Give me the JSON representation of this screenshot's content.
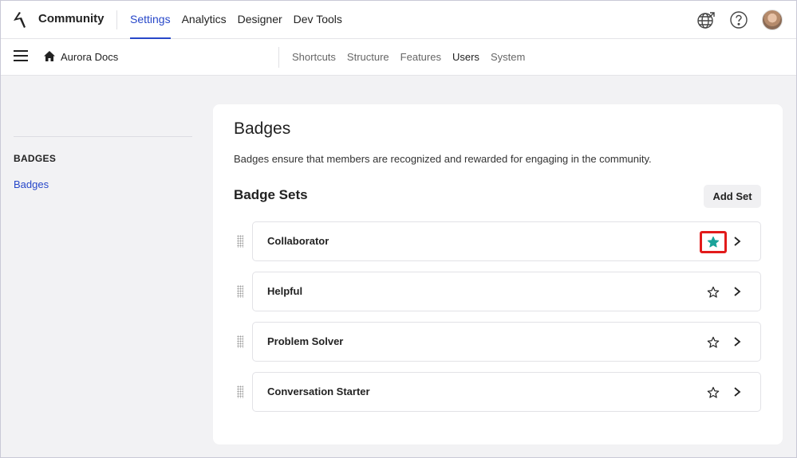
{
  "header": {
    "app_title": "Community",
    "tabs": [
      {
        "label": "Settings",
        "active": true
      },
      {
        "label": "Analytics",
        "active": false
      },
      {
        "label": "Designer",
        "active": false
      },
      {
        "label": "Dev Tools",
        "active": false
      }
    ],
    "icons": [
      "globe-icon",
      "help-icon",
      "avatar"
    ]
  },
  "subheader": {
    "site_name": "Aurora Docs",
    "tabs": [
      {
        "label": "Shortcuts",
        "active": false
      },
      {
        "label": "Structure",
        "active": false
      },
      {
        "label": "Features",
        "active": false
      },
      {
        "label": "Users",
        "active": true
      },
      {
        "label": "System",
        "active": false
      }
    ]
  },
  "sidebar": {
    "heading": "BADGES",
    "link": "Badges"
  },
  "main": {
    "title": "Badges",
    "description": "Badges ensure that members are recognized and rewarded for engaging in the community.",
    "sets_title": "Badge Sets",
    "add_button": "Add Set",
    "badge_sets": [
      {
        "label": "Collaborator",
        "starred": true
      },
      {
        "label": "Helpful",
        "starred": false
      },
      {
        "label": "Problem Solver",
        "starred": false
      },
      {
        "label": "Conversation Starter",
        "starred": false
      }
    ]
  },
  "colors": {
    "accent": "#2747c9",
    "star_filled": "#1aa39a",
    "highlight": "#e21b1b"
  }
}
